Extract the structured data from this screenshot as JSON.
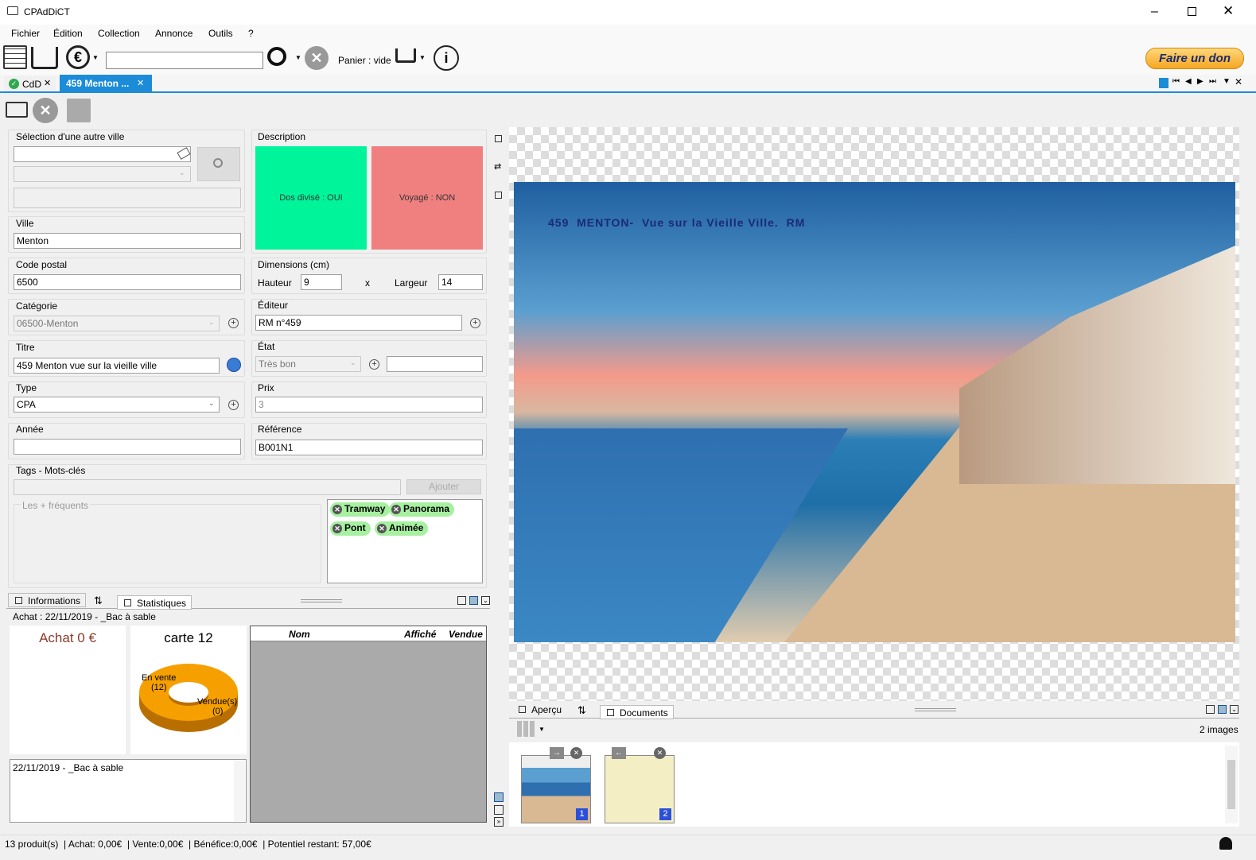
{
  "window": {
    "title": "CPAdDiCT"
  },
  "menu": [
    "Fichier",
    "Édition",
    "Collection",
    "Annonce",
    "Outils",
    "?"
  ],
  "toolbar": {
    "search_value": "",
    "cart_label": "Panier : vide",
    "donate_label": "Faire un don"
  },
  "tabs": [
    {
      "label": "CdD"
    },
    {
      "label": "459 Menton ..."
    }
  ],
  "form": {
    "other_city_label": "Sélection d'une autre ville",
    "ville_label": "Ville",
    "ville_value": "Menton",
    "cp_label": "Code postal",
    "cp_value": "6500",
    "categorie_label": "Catégorie",
    "categorie_value": "06500-Menton",
    "titre_label": "Titre",
    "titre_value": "459 Menton vue sur la vieille ville",
    "type_label": "Type",
    "type_value": "CPA",
    "annee_label": "Année",
    "annee_value": "",
    "description_label": "Description",
    "dos_divise": "Dos divisé : OUI",
    "voyage": "Voyagé : NON",
    "dimensions_label": "Dimensions (cm)",
    "hauteur_label": "Hauteur",
    "hauteur_value": "9",
    "times": "x",
    "largeur_label": "Largeur",
    "largeur_value": "14",
    "editeur_label": "Éditeur",
    "editeur_value": "RM n°459",
    "etat_label": "État",
    "etat_value": "Très bon",
    "prix_label": "Prix",
    "prix_value": "3",
    "reference_label": "Référence",
    "reference_value": "B001N1",
    "tags_label": "Tags - Mots-clés",
    "add_label": "Ajouter",
    "frequent_label": "Les + fréquents",
    "tags": [
      "Tramway",
      "Panorama",
      "Pont",
      "Animée"
    ]
  },
  "info_panel": {
    "tab_info": "Informations",
    "tab_stats": "Statistiques",
    "achat_line": "Achat : 22/11/2019 - _Bac à sable",
    "achat_total": "Achat 0 €",
    "carte_label": "carte 12",
    "donut_en_vente": "En vente",
    "donut_en_vente_count": "(12)",
    "donut_vendues": "Vendue(s)",
    "donut_vendues_count": "(0)",
    "table_headers": [
      "Nom",
      "Affiché",
      "Vendue"
    ],
    "history_entry": "22/11/2019 - _Bac à sable"
  },
  "image_panel": {
    "postcard_caption": "459  MENTON-  Vue sur la Vieille Ville.  RM",
    "tab_apercu": "Aperçu",
    "tab_documents": "Documents",
    "image_count": "2 images",
    "thumb1_num": "1",
    "thumb2_num": "2"
  },
  "status": {
    "text": "13 produit(s)  | Achat: 0,00€  | Vente:0,00€  | Bénéfice:0,00€  | Potentiel restant: 57,00€"
  },
  "colors": {
    "accent": "#1c8bd8",
    "oui": "#00f59a",
    "non": "#f08080",
    "tag": "#a6f0a0",
    "donut": "#f5a000"
  }
}
